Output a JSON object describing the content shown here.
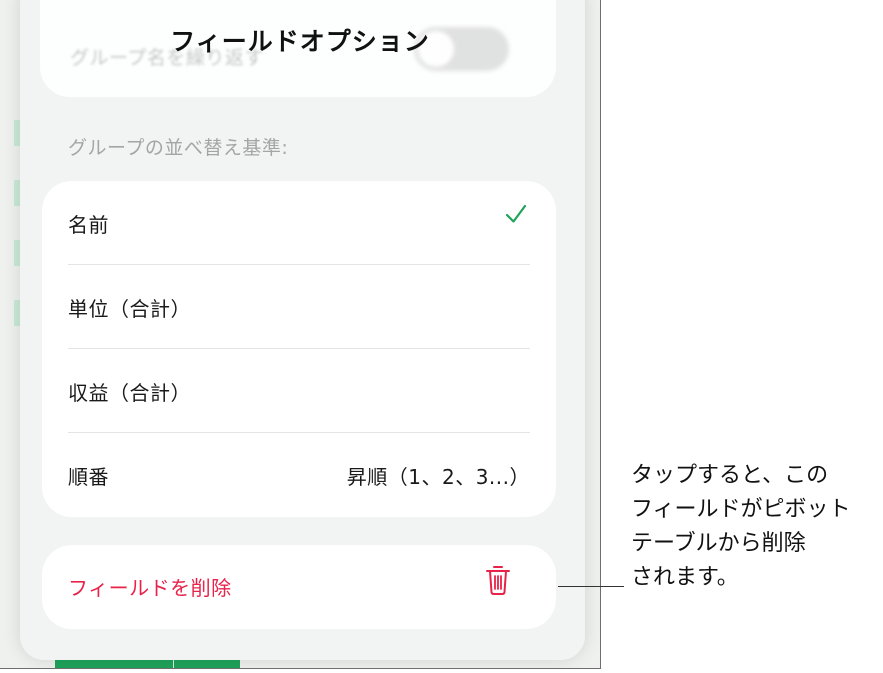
{
  "sheet": {
    "title": "フィールドオプション",
    "repeat_group_label": "グループ名を繰り返す",
    "sort_section_label": "グループの並べ替え基準:",
    "options": [
      {
        "label": "名前",
        "selected": true,
        "value": ""
      },
      {
        "label": "単位（合計）",
        "selected": false,
        "value": ""
      },
      {
        "label": "収益（合計）",
        "selected": false,
        "value": ""
      },
      {
        "label": "順番",
        "selected": false,
        "value": "昇順（1、2、3...）"
      }
    ],
    "delete_label": "フィールドを削除",
    "icons": {
      "checkmark": "checkmark-icon",
      "trash": "trash-icon"
    }
  },
  "callout": {
    "text": "タップすると、この\nフィールドがピボット\nテーブルから削除\nされます。"
  },
  "colors": {
    "accent_check": "#1fa35a",
    "destructive": "#e8234a",
    "background_green": "#1fa35a"
  }
}
